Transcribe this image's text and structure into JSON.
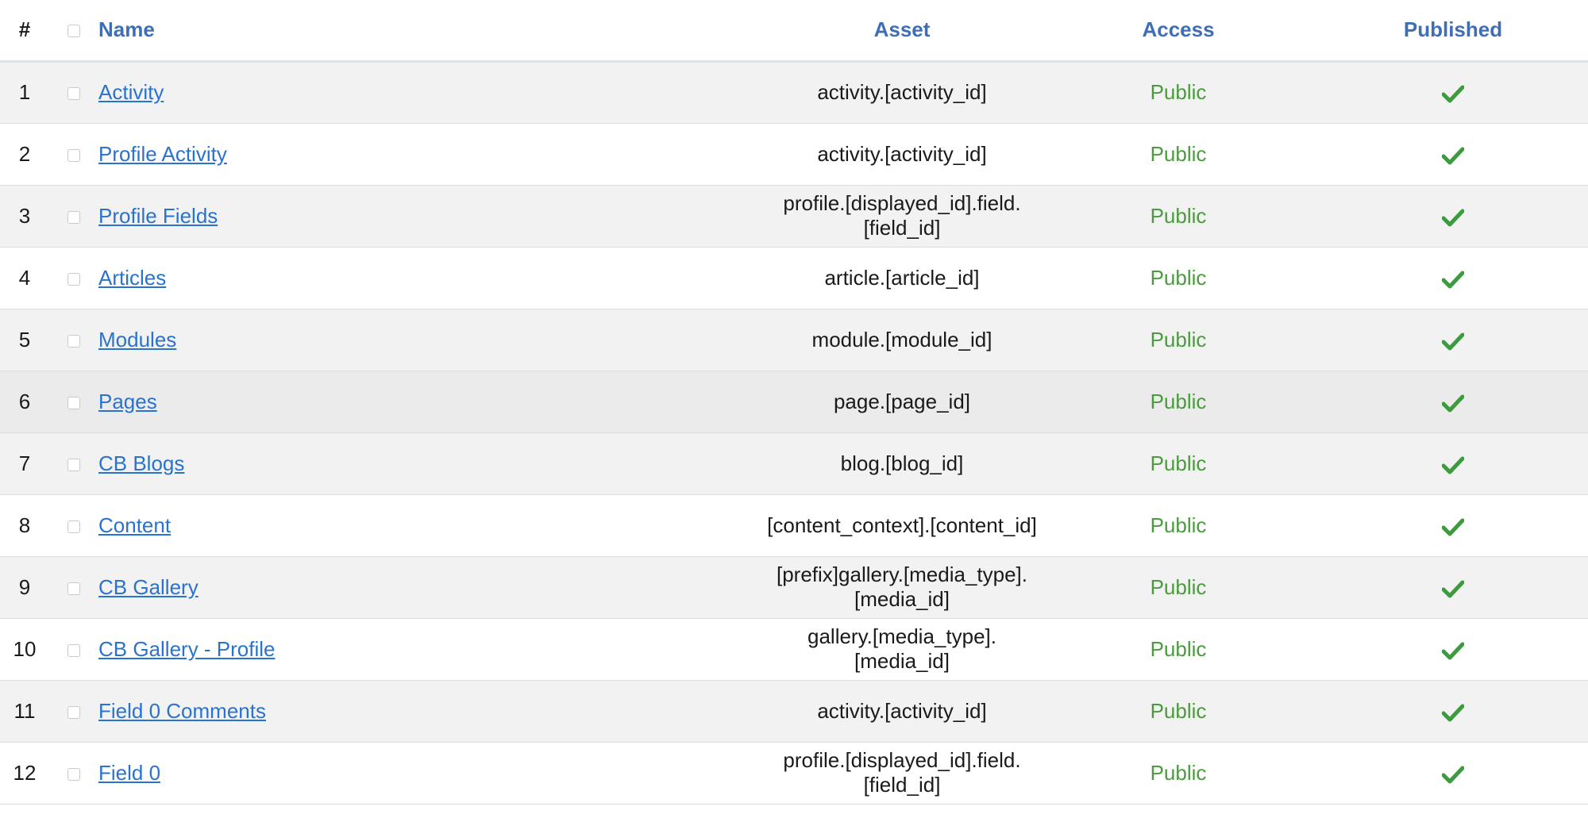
{
  "table": {
    "headers": {
      "num": "#",
      "name": "Name",
      "asset": "Asset",
      "access": "Access",
      "published": "Published"
    },
    "rows": [
      {
        "num": "1",
        "name": "Activity",
        "asset": "activity.[activity_id]",
        "access": "Public",
        "published": true
      },
      {
        "num": "2",
        "name": "Profile Activity",
        "asset": "activity.[activity_id]",
        "access": "Public",
        "published": true
      },
      {
        "num": "3",
        "name": "Profile Fields",
        "asset": "profile.[displayed_id].field.[field_id]",
        "access": "Public",
        "published": true
      },
      {
        "num": "4",
        "name": "Articles",
        "asset": "article.[article_id]",
        "access": "Public",
        "published": true
      },
      {
        "num": "5",
        "name": "Modules",
        "asset": "module.[module_id]",
        "access": "Public",
        "published": true
      },
      {
        "num": "6",
        "name": "Pages",
        "asset": "page.[page_id]",
        "access": "Public",
        "published": true
      },
      {
        "num": "7",
        "name": "CB Blogs",
        "asset": "blog.[blog_id]",
        "access": "Public",
        "published": true
      },
      {
        "num": "8",
        "name": "Content",
        "asset": "[content_context].[content_id]",
        "access": "Public",
        "published": true
      },
      {
        "num": "9",
        "name": "CB Gallery",
        "asset": "[prefix]gallery.[media_type].[media_id]",
        "access": "Public",
        "published": true
      },
      {
        "num": "10",
        "name": "CB Gallery - Profile",
        "asset": "gallery.[media_type].[media_id]",
        "access": "Public",
        "published": true
      },
      {
        "num": "11",
        "name": "Field 0 Comments",
        "asset": "activity.[activity_id]",
        "access": "Public",
        "published": true
      },
      {
        "num": "12",
        "name": "Field 0",
        "asset": "profile.[displayed_id].field.[field_id]",
        "access": "Public",
        "published": true
      }
    ]
  },
  "colors": {
    "header_link": "#3e6fb6",
    "name_link": "#2a72d0",
    "access_green": "#4a9b3e",
    "check_green": "#3e9a3e"
  }
}
